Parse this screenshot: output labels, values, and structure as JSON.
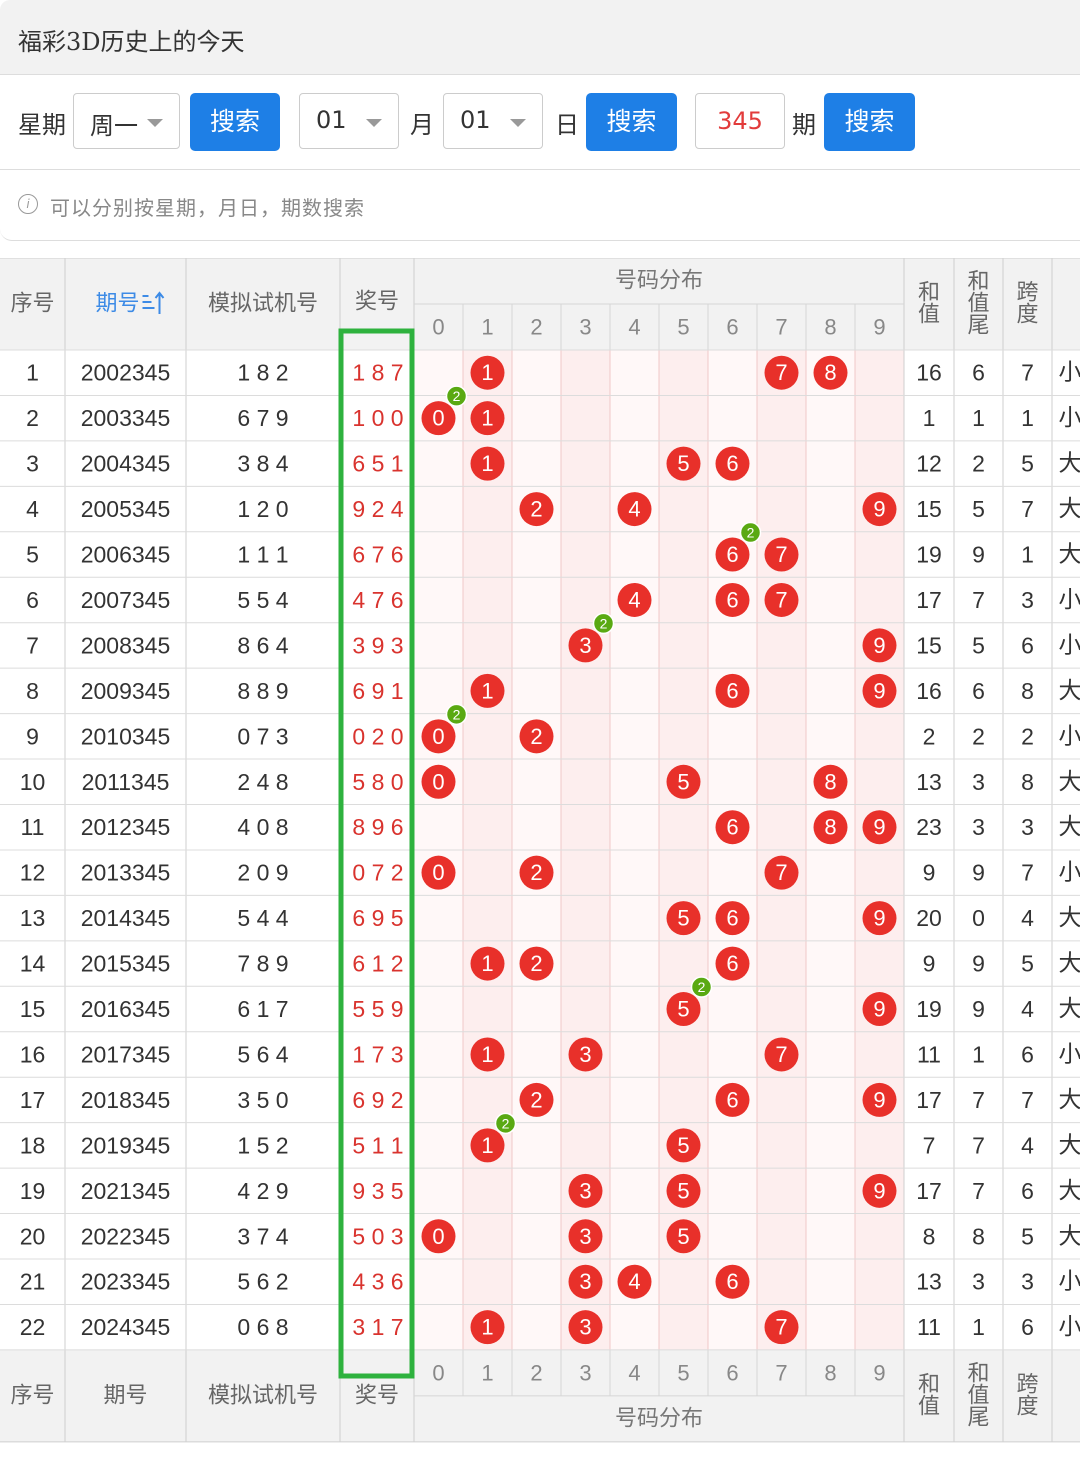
{
  "title": "福彩3D历史上的今天",
  "search": {
    "weekday_label": "星期",
    "weekday_value": "周一",
    "search_button": "搜索",
    "month_value": "01",
    "month_label": "月",
    "day_value": "01",
    "day_label": "日",
    "issue_value": "345",
    "issue_label": "期"
  },
  "tip": "可以分别按星期，月日，期数搜索",
  "table": {
    "header": {
      "seq": "序号",
      "issue": "期号",
      "sim": "模拟试机号",
      "prize": "奖号",
      "dist": "号码分布",
      "digits": [
        "0",
        "1",
        "2",
        "3",
        "4",
        "5",
        "6",
        "7",
        "8",
        "9"
      ],
      "sum": "和值",
      "sum_tail": "和值尾",
      "span": "跨度"
    },
    "rows": [
      {
        "seq": "1",
        "issue": "2002345",
        "sim": "1 8 2",
        "prize": "1 8 7",
        "sum": "16",
        "tail": "6",
        "span": "7",
        "size": "小"
      },
      {
        "seq": "2",
        "issue": "2003345",
        "sim": "6 7 9",
        "prize": "1 0 0",
        "sum": "1",
        "tail": "1",
        "span": "1",
        "size": "小"
      },
      {
        "seq": "3",
        "issue": "2004345",
        "sim": "3 8 4",
        "prize": "6 5 1",
        "sum": "12",
        "tail": "2",
        "span": "5",
        "size": "大"
      },
      {
        "seq": "4",
        "issue": "2005345",
        "sim": "1 2 0",
        "prize": "9 2 4",
        "sum": "15",
        "tail": "5",
        "span": "7",
        "size": "大"
      },
      {
        "seq": "5",
        "issue": "2006345",
        "sim": "1 1 1",
        "prize": "6 7 6",
        "sum": "19",
        "tail": "9",
        "span": "1",
        "size": "大"
      },
      {
        "seq": "6",
        "issue": "2007345",
        "sim": "5 5 4",
        "prize": "4 7 6",
        "sum": "17",
        "tail": "7",
        "span": "3",
        "size": "小"
      },
      {
        "seq": "7",
        "issue": "2008345",
        "sim": "8 6 4",
        "prize": "3 9 3",
        "sum": "15",
        "tail": "5",
        "span": "6",
        "size": "小"
      },
      {
        "seq": "8",
        "issue": "2009345",
        "sim": "8 8 9",
        "prize": "6 9 1",
        "sum": "16",
        "tail": "6",
        "span": "8",
        "size": "大"
      },
      {
        "seq": "9",
        "issue": "2010345",
        "sim": "0 7 3",
        "prize": "0 2 0",
        "sum": "2",
        "tail": "2",
        "span": "2",
        "size": "小"
      },
      {
        "seq": "10",
        "issue": "2011345",
        "sim": "2 4 8",
        "prize": "5 8 0",
        "sum": "13",
        "tail": "3",
        "span": "8",
        "size": "大"
      },
      {
        "seq": "11",
        "issue": "2012345",
        "sim": "4 0 8",
        "prize": "8 9 6",
        "sum": "23",
        "tail": "3",
        "span": "3",
        "size": "大"
      },
      {
        "seq": "12",
        "issue": "2013345",
        "sim": "2 0 9",
        "prize": "0 7 2",
        "sum": "9",
        "tail": "9",
        "span": "7",
        "size": "小"
      },
      {
        "seq": "13",
        "issue": "2014345",
        "sim": "5 4 4",
        "prize": "6 9 5",
        "sum": "20",
        "tail": "0",
        "span": "4",
        "size": "大"
      },
      {
        "seq": "14",
        "issue": "2015345",
        "sim": "7 8 9",
        "prize": "6 1 2",
        "sum": "9",
        "tail": "9",
        "span": "5",
        "size": "大"
      },
      {
        "seq": "15",
        "issue": "2016345",
        "sim": "6 1 7",
        "prize": "5 5 9",
        "sum": "19",
        "tail": "9",
        "span": "4",
        "size": "大"
      },
      {
        "seq": "16",
        "issue": "2017345",
        "sim": "5 6 4",
        "prize": "1 7 3",
        "sum": "11",
        "tail": "1",
        "span": "6",
        "size": "小"
      },
      {
        "seq": "17",
        "issue": "2018345",
        "sim": "3 5 0",
        "prize": "6 9 2",
        "sum": "17",
        "tail": "7",
        "span": "7",
        "size": "大"
      },
      {
        "seq": "18",
        "issue": "2019345",
        "sim": "1 5 2",
        "prize": "5 1 1",
        "sum": "7",
        "tail": "7",
        "span": "4",
        "size": "大"
      },
      {
        "seq": "19",
        "issue": "2021345",
        "sim": "4 2 9",
        "prize": "9 3 5",
        "sum": "17",
        "tail": "7",
        "span": "6",
        "size": "大"
      },
      {
        "seq": "20",
        "issue": "2022345",
        "sim": "3 7 4",
        "prize": "5 0 3",
        "sum": "8",
        "tail": "8",
        "span": "5",
        "size": "大"
      },
      {
        "seq": "21",
        "issue": "2023345",
        "sim": "5 6 2",
        "prize": "4 3 6",
        "sum": "13",
        "tail": "3",
        "span": "3",
        "size": "小"
      },
      {
        "seq": "22",
        "issue": "2024345",
        "sim": "0 6 8",
        "prize": "3 1 7",
        "sum": "11",
        "tail": "1",
        "span": "6",
        "size": "小"
      }
    ],
    "repeat_badge": "2"
  },
  "colors": {
    "ball": "#e8302a",
    "badge": "#5aa912",
    "highlight_border": "#2eb23e",
    "prize_text": "#d9332e",
    "header_bg": "#f2f2f2",
    "dist_alt_bg": "#fdeeee",
    "sort_active": "#3d8be6"
  }
}
